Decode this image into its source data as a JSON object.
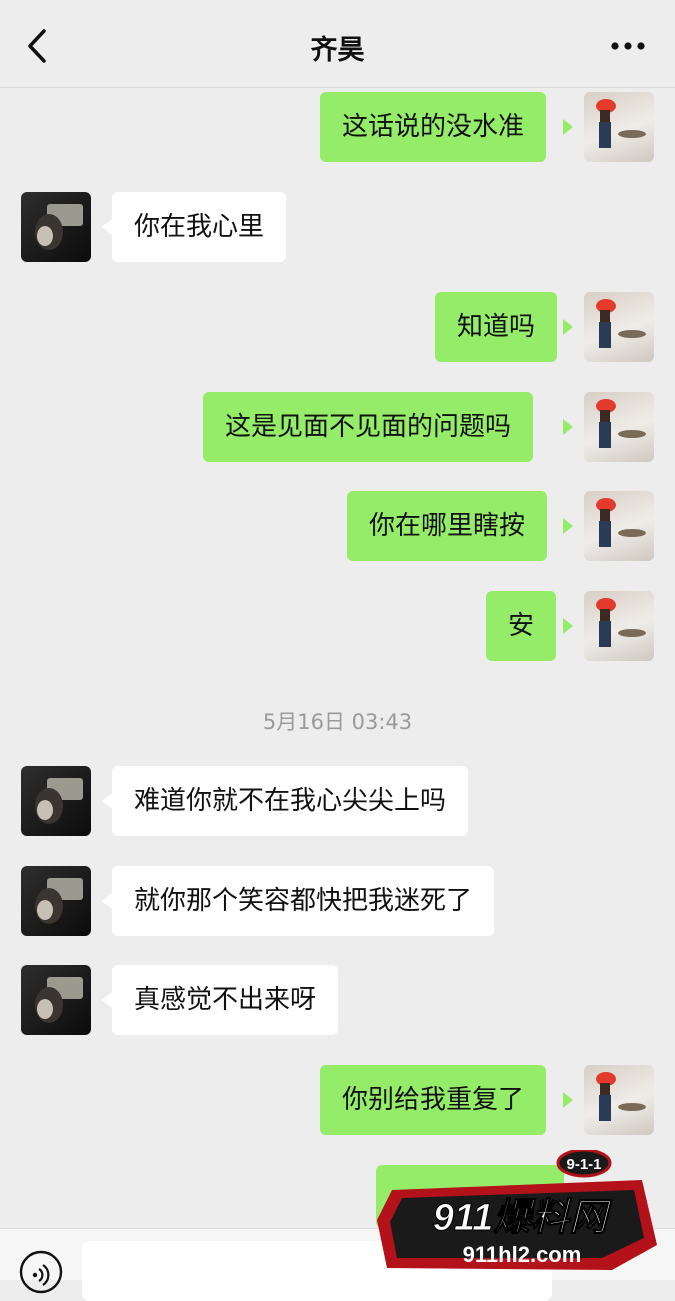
{
  "header": {
    "title": "齐昊"
  },
  "messages": [
    {
      "side": "right",
      "text": "这话说的没水准"
    },
    {
      "side": "left",
      "text": "你在我心里"
    },
    {
      "side": "right",
      "text": "知道吗"
    },
    {
      "side": "right",
      "text": "这是见面不见面的问题吗"
    },
    {
      "side": "right",
      "text": "你在哪里瞎按"
    },
    {
      "side": "right",
      "text": "安"
    },
    {
      "side": "left",
      "text": "难道你就不在我心尖尖上吗"
    },
    {
      "side": "left",
      "text": "就你那个笑容都快把我迷死了"
    },
    {
      "side": "left",
      "text": "真感觉不出来呀"
    },
    {
      "side": "right",
      "text": "你别给我重复了"
    }
  ],
  "timestamp": "5月16日 03:43",
  "watermark": {
    "badge": "9-1-1",
    "brand": "911爆料网",
    "url": "911hl2.com"
  },
  "colors": {
    "background": "#ededed",
    "my_bubble": "#95ec69",
    "their_bubble": "#ffffff",
    "timestamp_text": "#9a9a9a"
  },
  "icons": [
    "back-icon",
    "more-icon",
    "voice-icon"
  ]
}
